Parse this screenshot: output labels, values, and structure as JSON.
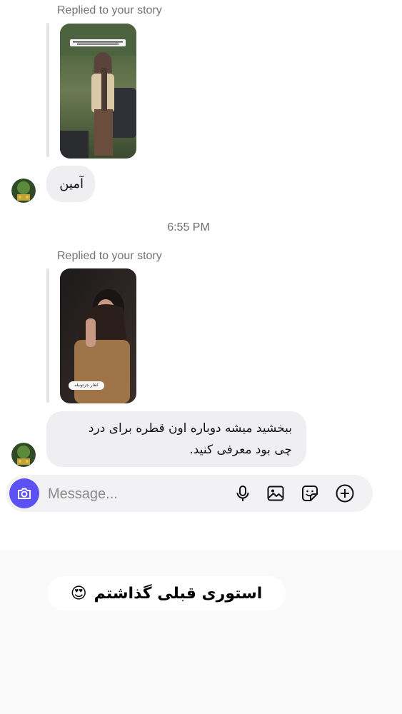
{
  "thread": {
    "story_reply_1": {
      "label": "Replied to your story"
    },
    "message_1": {
      "text": "آمین"
    },
    "timestamp": "6:55 PM",
    "story_reply_2": {
      "label": "Replied to your story",
      "sticker_text": "انقار جرتونیله"
    },
    "message_2": {
      "line1": "ببخشید میشه دوباره اون قطره برای درد",
      "line2": "چی بود معرفی کنید."
    }
  },
  "composer": {
    "placeholder": "Message...",
    "icons": [
      "camera-icon",
      "microphone-icon",
      "image-icon",
      "sticker-icon",
      "plus-circle-icon"
    ],
    "accent": "#5b51f5"
  },
  "caption": {
    "text": "استوری قبلی  گذاشتم",
    "emoji": "😍"
  }
}
